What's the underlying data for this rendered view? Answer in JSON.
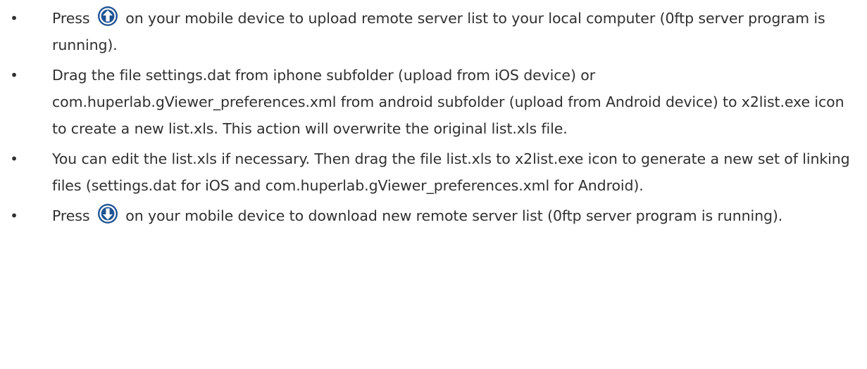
{
  "bullet_char": "•",
  "items": [
    {
      "before_icon": "Press",
      "icon": "upload-arrow-circle-icon",
      "after_icon": "on your mobile device to upload remote server list to your local computer (0ftp server program is running)."
    },
    {
      "text": "Drag the file settings.dat from iphone subfolder (upload from iOS device) or com.huperlab.gViewer_preferences.xml from android subfolder (upload from Android device) to x2list.exe icon to create a new list.xls. This action will overwrite the original list.xls file."
    },
    {
      "text": "You can edit the list.xls if necessary. Then drag the file list.xls to x2list.exe icon to generate a new set of linking files (settings.dat for iOS and com.huperlab.gViewer_preferences.xml for Android)."
    },
    {
      "before_icon": "Press",
      "icon": "download-arrow-circle-icon",
      "after_icon": "on your mobile device to download new remote server list (0ftp server program is running)."
    }
  ],
  "colors": {
    "text": "#303030",
    "icon_fill": "#1f5394"
  }
}
